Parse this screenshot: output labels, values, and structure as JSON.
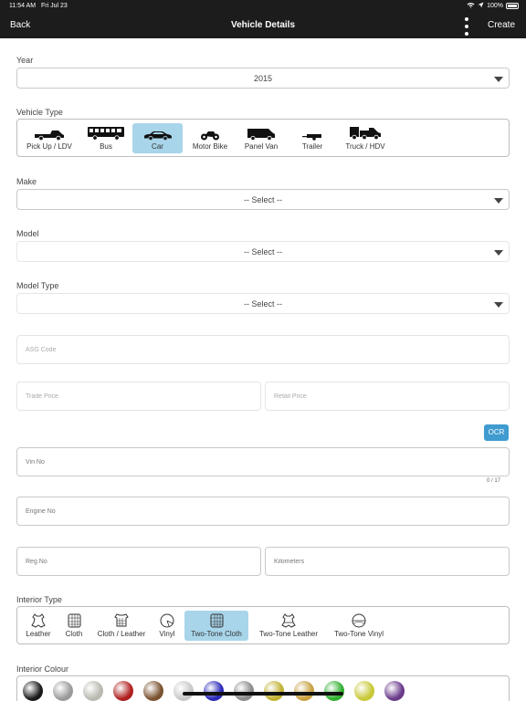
{
  "status": {
    "time": "11:54 AM",
    "date": "Fri Jul 23",
    "battery": "100%"
  },
  "nav": {
    "back": "Back",
    "title": "Vehicle Details",
    "create": "Create"
  },
  "year": {
    "label": "Year",
    "value": "2015"
  },
  "vehicle_type": {
    "label": "Vehicle Type",
    "selected": "Car",
    "options": [
      {
        "label": "Pick Up / LDV",
        "icon": "pickup-icon"
      },
      {
        "label": "Bus",
        "icon": "bus-icon"
      },
      {
        "label": "Car",
        "icon": "car-icon"
      },
      {
        "label": "Motor Bike",
        "icon": "motorbike-icon"
      },
      {
        "label": "Panel Van",
        "icon": "panel-van-icon"
      },
      {
        "label": "Trailer",
        "icon": "trailer-icon"
      },
      {
        "label": "Truck / HDV",
        "icon": "truck-icon"
      }
    ]
  },
  "make": {
    "label": "Make",
    "value": "-- Select --"
  },
  "model": {
    "label": "Model",
    "value": "-- Select --"
  },
  "model_type": {
    "label": "Model Type",
    "value": "-- Select --"
  },
  "fields": {
    "asg_code": "ASG Code",
    "trade_price": "Trade Price",
    "retail_price": "Retail Price",
    "ocr": "OCR",
    "vin_no": "Vin No",
    "vin_counter": "0 / 17",
    "engine_no": "Engine No",
    "reg_no": "Reg No",
    "kilometers": "Kilometers"
  },
  "interior_type": {
    "label": "Interior Type",
    "selected": "Two-Tone Cloth",
    "options": [
      {
        "label": "Leather",
        "icon": "leather-icon"
      },
      {
        "label": "Cloth",
        "icon": "cloth-icon"
      },
      {
        "label": "Cloth / Leather",
        "icon": "cloth-leather-icon"
      },
      {
        "label": "Vinyl",
        "icon": "vinyl-icon"
      },
      {
        "label": "Two-Tone Cloth",
        "icon": "two-tone-cloth-icon"
      },
      {
        "label": "Two-Tone Leather",
        "icon": "two-tone-leather-icon"
      },
      {
        "label": "Two-Tone Vinyl",
        "icon": "two-tone-vinyl-icon"
      }
    ]
  },
  "interior_colour": {
    "label": "Interior Colour",
    "swatches": [
      "#1a1a1a",
      "#9a9a9a",
      "#b9b9b0",
      "#b02020",
      "#7a5230",
      "#c8c8c8",
      "#2a2ab8",
      "#8a8a8a",
      "#c0b030",
      "#c8a040",
      "#30b030",
      "#c8c838",
      "#6a3a8a"
    ]
  }
}
